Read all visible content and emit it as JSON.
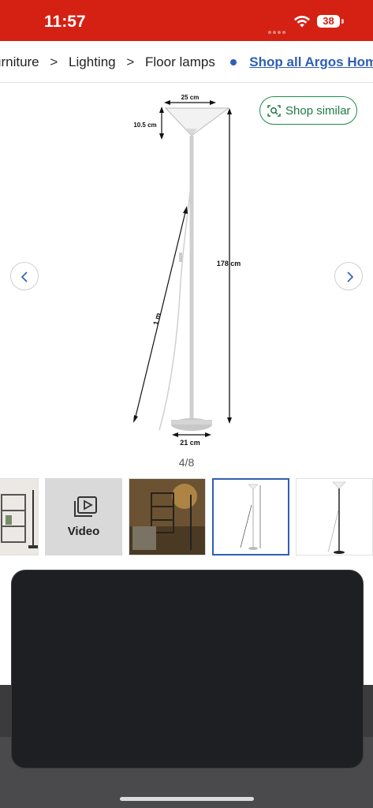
{
  "status_bar": {
    "time": "11:57",
    "battery": "38",
    "bg_color": "#d42114"
  },
  "breadcrumb": {
    "items": [
      "urniture",
      "Lighting",
      "Floor lamps"
    ],
    "separator": ">",
    "link": "Shop all Argos Home",
    "link_color": "#2f5fb3"
  },
  "product_image": {
    "dimensions": {
      "shade_width": "25 cm",
      "shade_height": "10.5 cm",
      "total_height": "178 cm",
      "cable_length": "1 m",
      "base_width": "21 cm"
    }
  },
  "shop_similar": {
    "label": "Shop similar",
    "icon": "camera-search-icon",
    "color": "#1e8c4e"
  },
  "gallery": {
    "page_indicator": "4/8",
    "thumbs": [
      {
        "type": "room-photo"
      },
      {
        "type": "video",
        "label": "Video",
        "icon": "video-play-icon"
      },
      {
        "type": "room-photo-lit"
      },
      {
        "type": "diagram",
        "selected": true
      },
      {
        "type": "product-photo"
      }
    ]
  },
  "icons": {
    "prev": "chevron-left-icon",
    "next": "chevron-right-icon",
    "wifi": "wifi-icon"
  }
}
